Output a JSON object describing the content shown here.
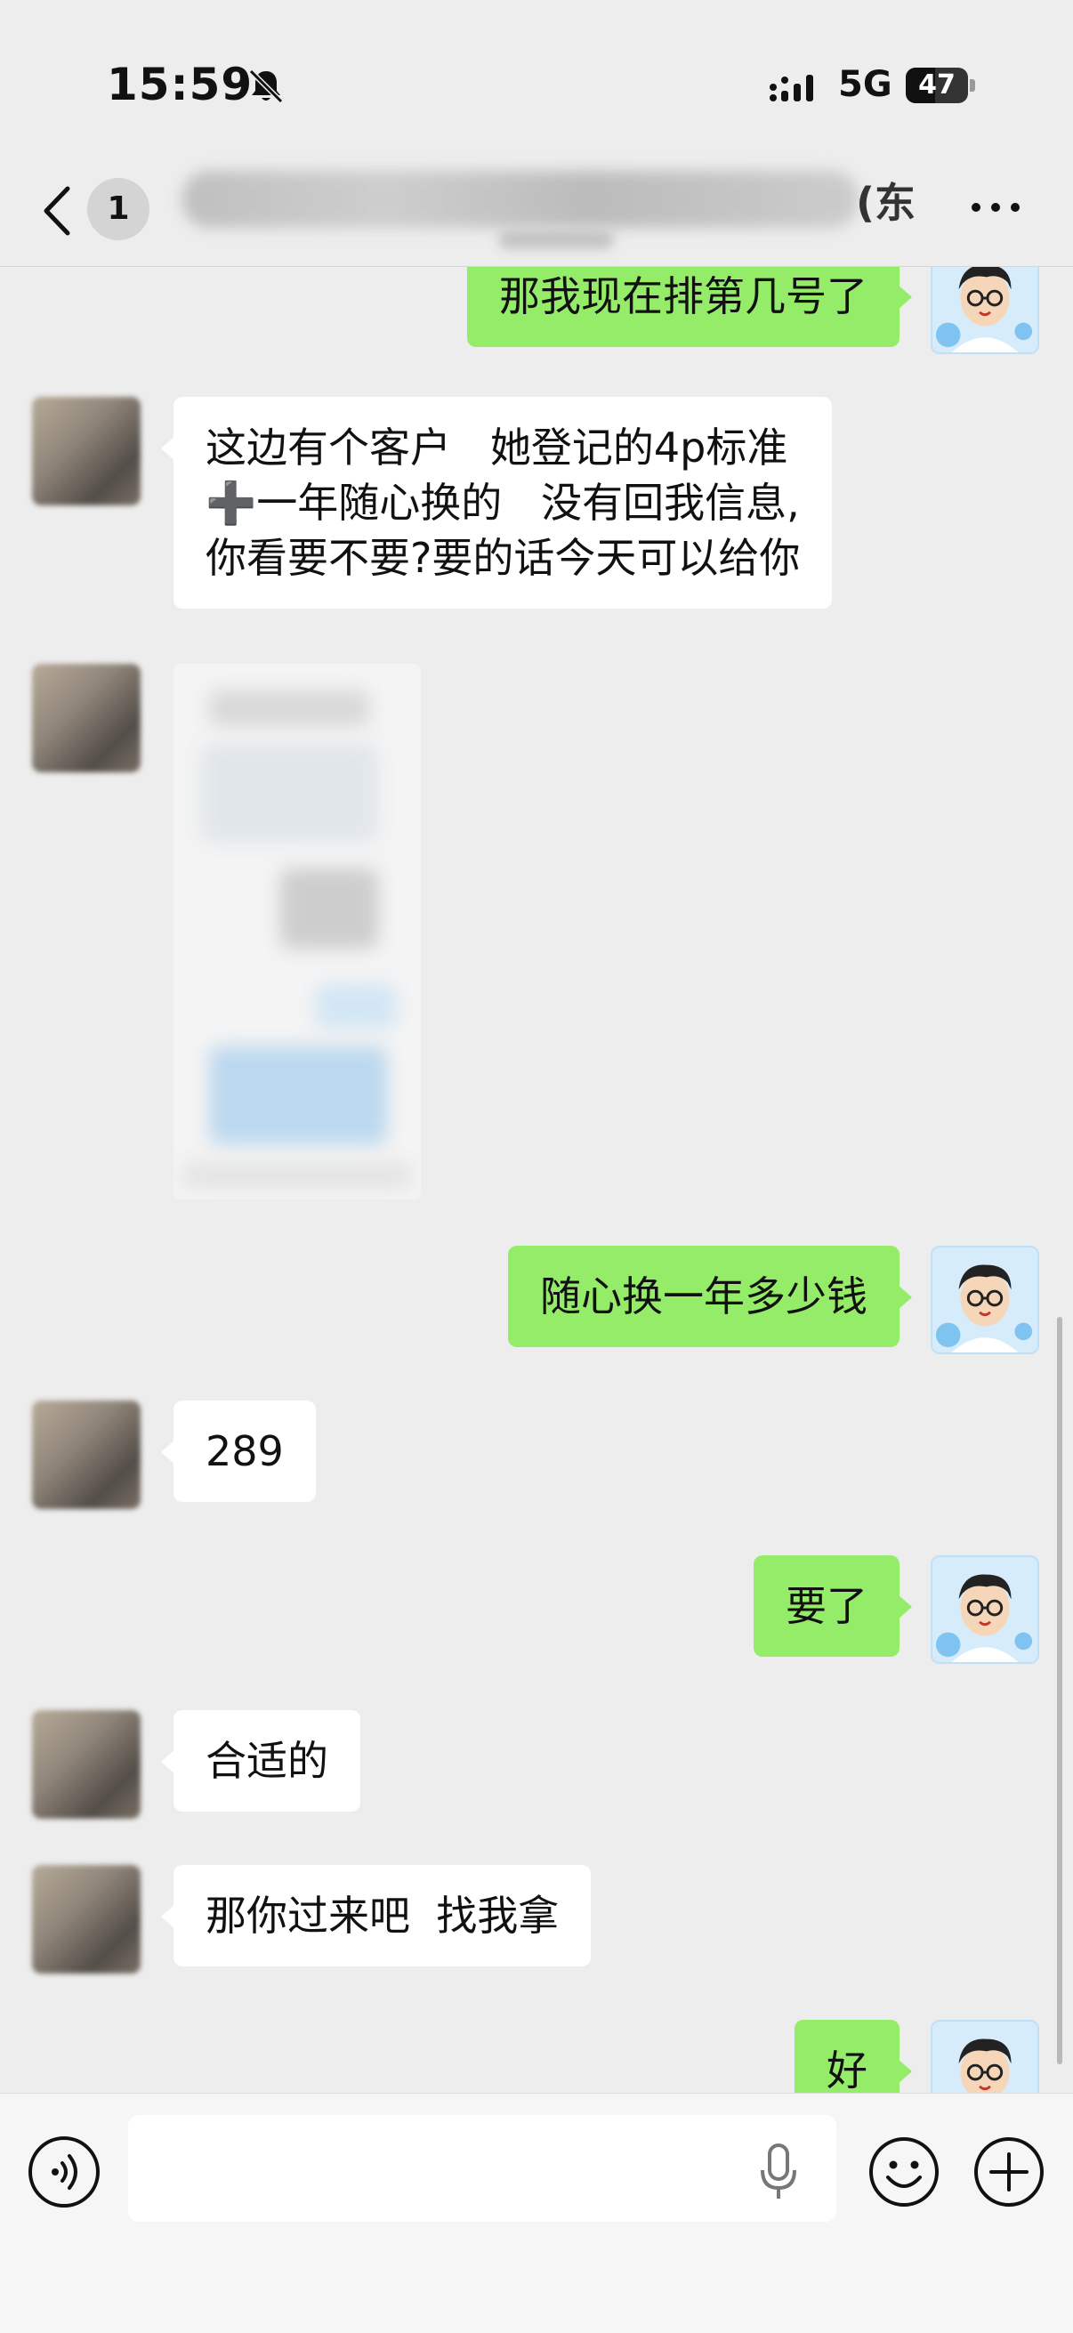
{
  "status_bar": {
    "time": "15:59",
    "network": "5G",
    "battery": "47",
    "battery_level": 0.47,
    "icons": [
      "bell-slash-icon",
      "signal-icon",
      "battery-icon"
    ]
  },
  "nav": {
    "back_icon": "chevron-left-icon",
    "unread_count": "1",
    "title_visible_suffix": "(东",
    "more_icon": "ellipsis-icon"
  },
  "messages": [
    {
      "side": "right",
      "type": "text",
      "text": "那我现在排第几号了"
    },
    {
      "side": "left",
      "type": "text",
      "text": "这边有个客户   她登记的4p标准\n➕一年随心换的   没有回我信息,\n你看要不要?要的话今天可以给你"
    },
    {
      "side": "left",
      "type": "image"
    },
    {
      "side": "right",
      "type": "text",
      "text": "随心换一年多少钱"
    },
    {
      "side": "left",
      "type": "text",
      "text": "289"
    },
    {
      "side": "right",
      "type": "text",
      "text": "要了"
    },
    {
      "side": "left",
      "type": "text",
      "text": "合适的"
    },
    {
      "side": "left",
      "type": "text",
      "text": "那你过来吧  找我拿"
    },
    {
      "side": "right",
      "type": "text",
      "text": "好"
    }
  ],
  "input_bar": {
    "value": "",
    "icons": [
      "voice-icon",
      "mic-icon",
      "emoji-icon",
      "plus-icon"
    ]
  },
  "colors": {
    "background": "#ededed",
    "outgoing_bubble": "#95ec69",
    "incoming_bubble": "#ffffff"
  }
}
